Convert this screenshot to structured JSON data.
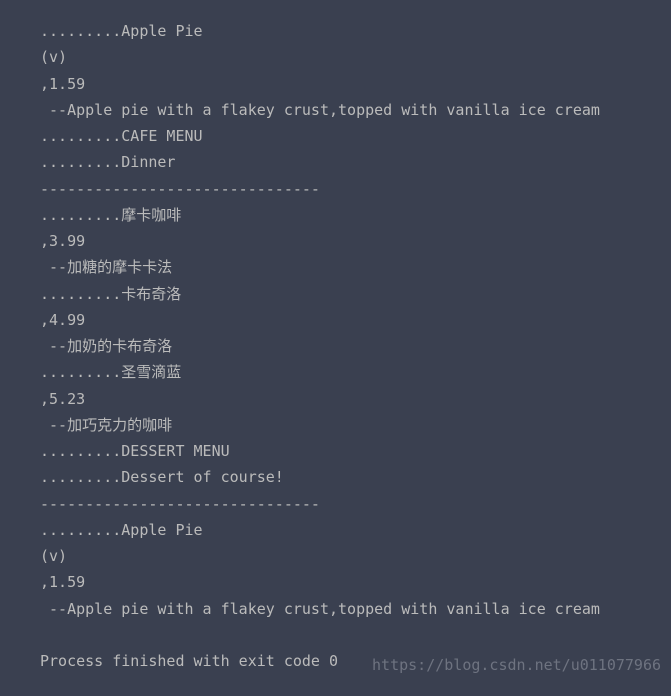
{
  "console": {
    "lines": [
      ".........Apple Pie",
      "(v)",
      ",1.59",
      " --Apple pie with a flakey crust,topped with vanilla ice cream",
      ".........CAFE MENU",
      ".........Dinner",
      "-------------------------------",
      ".........摩卡咖啡",
      ",3.99",
      " --加糖的摩卡卡法",
      ".........卡布奇洛",
      ",4.99",
      " --加奶的卡布奇洛",
      ".........圣雪滴蓝",
      ",5.23",
      " --加巧克力的咖啡",
      ".........DESSERT MENU",
      ".........Dessert of course!",
      "-------------------------------",
      ".........Apple Pie",
      "(v)",
      ",1.59",
      " --Apple pie with a flakey crust,topped with vanilla ice cream",
      "",
      "Process finished with exit code 0"
    ]
  },
  "watermark": "https://blog.csdn.net/u011077966"
}
